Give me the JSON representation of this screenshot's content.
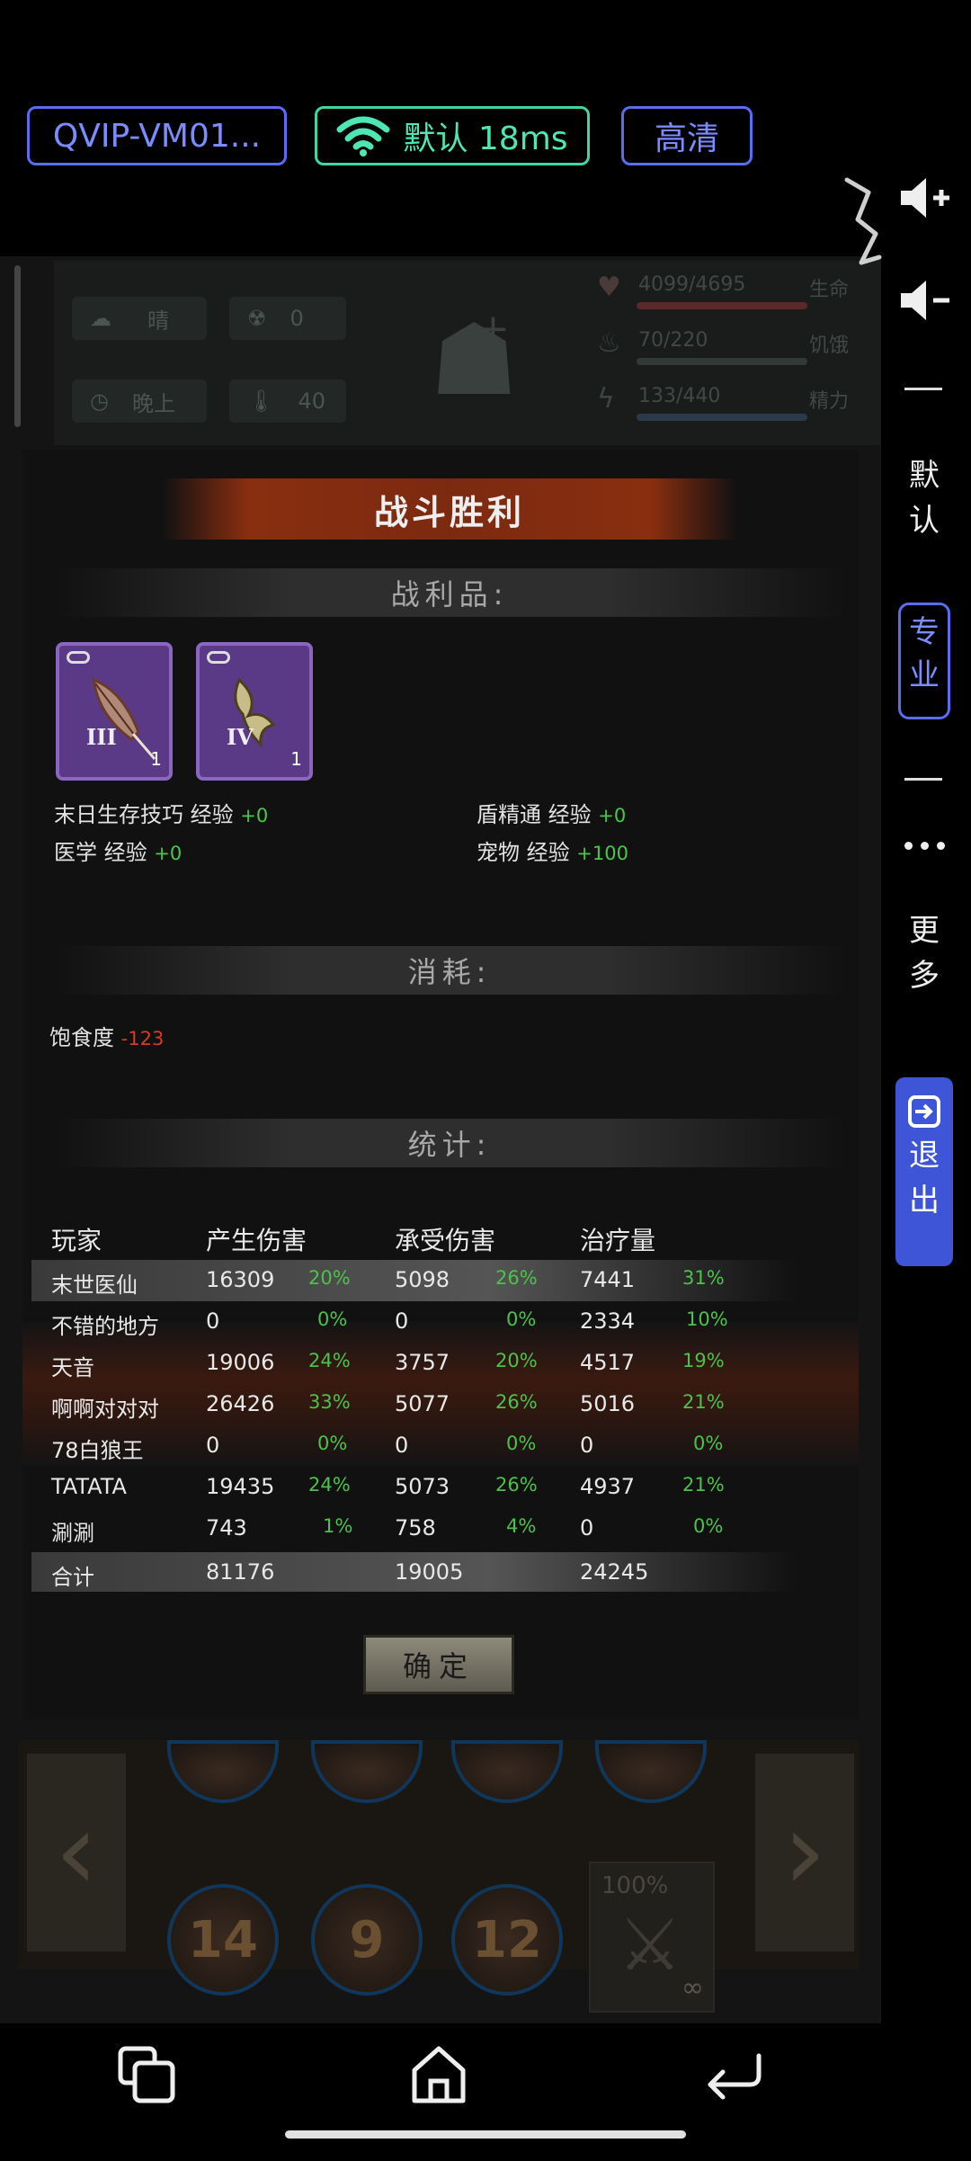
{
  "toolbar": {
    "device": "QVIP-VM01...",
    "network": "默认 18ms",
    "quality": "高清"
  },
  "side_toolbar": {
    "default_label": "默\n认",
    "pro_label": "专\n业",
    "more_label": "更\n多",
    "exit_label": "退\n出"
  },
  "hud": {
    "weather": "晴",
    "radiation": "0",
    "time": "晚上",
    "temperature": "40",
    "health": "4099/4695",
    "health_label": "生命",
    "hunger": "70/220",
    "hunger_label": "饥饿",
    "energy": "133/440",
    "energy_label": "精力"
  },
  "result": {
    "title": "战斗胜利",
    "loot_header": "战利品:",
    "loot": [
      {
        "roman": "III",
        "qty": "1"
      },
      {
        "roman": "IV",
        "qty": "1"
      }
    ],
    "exp": [
      {
        "label": "末日生存技巧 经验",
        "value": "+0"
      },
      {
        "label": "盾精通 经验",
        "value": "+0"
      },
      {
        "label": "医学 经验",
        "value": "+0"
      },
      {
        "label": "宠物 经验",
        "value": "+100"
      }
    ],
    "consume_header": "消耗:",
    "consume": {
      "label": "饱食度",
      "value": "-123"
    },
    "stats_header": "统计:",
    "stats_columns": [
      "玩家",
      "产生伤害",
      "承受伤害",
      "治疗量"
    ],
    "stats_rows": [
      {
        "player": "末世医仙",
        "dmg": "16309",
        "dmg_p": "20%",
        "taken": "5098",
        "taken_p": "26%",
        "heal": "7441",
        "heal_p": "31%"
      },
      {
        "player": "不错的地方",
        "dmg": "0",
        "dmg_p": "0%",
        "taken": "0",
        "taken_p": "0%",
        "heal": "2334",
        "heal_p": "10%"
      },
      {
        "player": "天音",
        "dmg": "19006",
        "dmg_p": "24%",
        "taken": "3757",
        "taken_p": "20%",
        "heal": "4517",
        "heal_p": "19%"
      },
      {
        "player": "啊啊对对对",
        "dmg": "26426",
        "dmg_p": "33%",
        "taken": "5077",
        "taken_p": "26%",
        "heal": "5016",
        "heal_p": "21%"
      },
      {
        "player": "78白狼王",
        "dmg": "0",
        "dmg_p": "0%",
        "taken": "0",
        "taken_p": "0%",
        "heal": "0",
        "heal_p": "0%"
      },
      {
        "player": "TATATA",
        "dmg": "19435",
        "dmg_p": "24%",
        "taken": "5073",
        "taken_p": "26%",
        "heal": "4937",
        "heal_p": "21%"
      },
      {
        "player": "涮涮",
        "dmg": "743",
        "dmg_p": "1%",
        "taken": "758",
        "taken_p": "4%",
        "heal": "0",
        "heal_p": "0%"
      }
    ],
    "total": {
      "label": "合计",
      "dmg": "81176",
      "taken": "19005",
      "heal": "24245"
    },
    "confirm": "确定"
  },
  "skills": {
    "charges": [
      "14",
      "9",
      "12"
    ],
    "weapon_durability": "100%",
    "weapon_ammo": "∞"
  }
}
